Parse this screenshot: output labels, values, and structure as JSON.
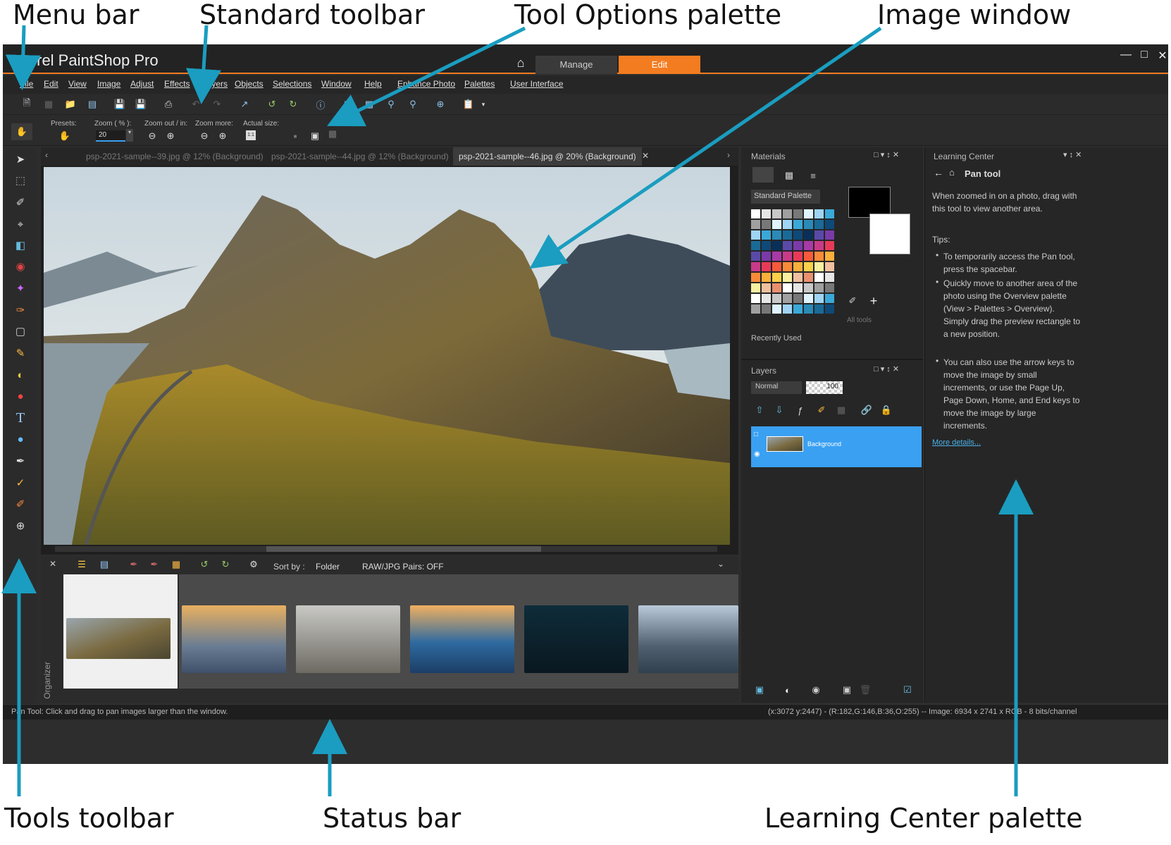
{
  "callouts": {
    "menu_bar": "Menu bar",
    "standard_toolbar": "Standard toolbar",
    "tool_options_palette": "Tool Options palette",
    "image_window": "Image window",
    "tools_toolbar": "Tools toolbar",
    "status_bar": "Status bar",
    "learning_center_palette": "Learning Center palette"
  },
  "app": {
    "name": "Corel PaintShop Pro",
    "tabs": [
      "Manage",
      "Edit"
    ],
    "active_tab": "Edit",
    "accent": "#f47c20"
  },
  "menu": [
    "File",
    "Edit",
    "View",
    "Image",
    "Adjust",
    "Effects",
    "Layers",
    "Objects",
    "Selections",
    "Window",
    "Help",
    "Enhance Photo",
    "Palettes",
    "User Interface"
  ],
  "tool_options": {
    "presets_label": "Presets:",
    "zoom_label": "Zoom ( % ):",
    "zoom_value": "20",
    "zoom_inout_label": "Zoom out / in:",
    "zoom_more_label": "Zoom more:",
    "actual_size_label": "Actual size:",
    "actual_size_value": "1:1"
  },
  "documents": [
    {
      "name": "psp-2021-sample--39.jpg @  12% (Background)",
      "active": false
    },
    {
      "name": "psp-2021-sample--44.jpg @  12% (Background)",
      "active": false
    },
    {
      "name": "psp-2021-sample--46.jpg @  20% (Background)",
      "active": true
    }
  ],
  "organizer": {
    "label": "Organizer",
    "sort_label": "Sort by :",
    "sort_value": "Folder",
    "raw_pairs": "RAW/JPG Pairs: OFF"
  },
  "materials": {
    "title": "Materials",
    "palette_select": "Standard Palette",
    "all_tools": "All tools",
    "recently_used": "Recently Used"
  },
  "layers": {
    "title": "Layers",
    "blend_mode": "Normal",
    "opacity": "100",
    "layer_name": "Background",
    "selected_color": "#3aa0f2"
  },
  "learning_center": {
    "title": "Learning Center",
    "heading": "Pan tool",
    "intro": "When zoomed in on a photo, drag with this tool to view another area.",
    "tips_label": "Tips:",
    "tips": [
      "To temporarily access the Pan tool, press the spacebar.",
      "Quickly move to another area of the photo using the Overview palette (View > Palettes > Overview). Simply drag the preview rectangle to a new position.",
      "You can also use the arrow keys to move the image by small increments, or use the Page Up, Page Down, Home, and End keys to move the image by large increments."
    ],
    "more_link": "More details..."
  },
  "status": {
    "left": "Pan Tool: Click and drag to pan images larger than the window.",
    "right": "(x:3072 y:2447) - (R:182,G:146,B:36,O:255) -- Image:  6934 x 2741 x RGB - 8 bits/channel"
  },
  "arrow_color": "#1a9dc0"
}
